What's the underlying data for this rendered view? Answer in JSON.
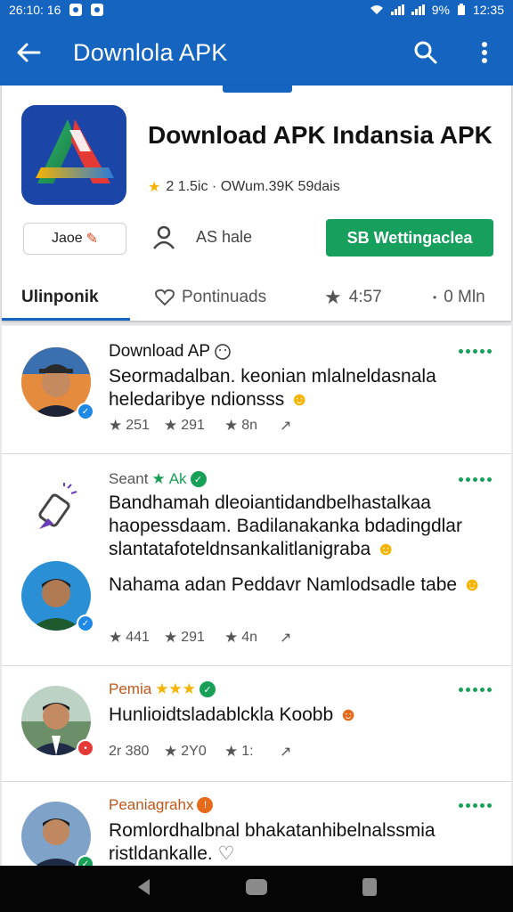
{
  "status_bar": {
    "time_left": "26:10: 16",
    "battery": "9%",
    "time_right": "12:35"
  },
  "app_bar": {
    "title": "Downlola APK"
  },
  "header": {
    "app_name": "Download APK Indansia APK",
    "rating_line": "2 1.5ic · OWum.39K 59dais",
    "chip_label": "Jaoe",
    "person_label": "AS hale",
    "install_label": "SB Wettingaclea",
    "tabs": [
      {
        "label": "Ulinponik"
      },
      {
        "label": "Pontinuads"
      },
      {
        "label": "4:57"
      },
      {
        "label": "0 Mln"
      }
    ]
  },
  "posts": [
    {
      "name": "Download AP",
      "text": "Seormadalban. keonian mlalneldasnala heledaribye ndionsss",
      "stats": [
        "251",
        "291",
        "8n"
      ]
    },
    {
      "name": "Seant",
      "name_tag": "Ak",
      "text": "Bandhamah dleoiantidandbelhastalkaa haopessdaam. Badilanakanka bdadingdlar slantatafoteldnsankalitlanigraba",
      "stats": []
    },
    {
      "name": "",
      "text": "Nahama adan Peddavr Namlodsadle tabe",
      "stats": [
        "441",
        "291",
        "4n"
      ]
    },
    {
      "name": "Pemia",
      "text": "Hunlioidtsladablckla Koobb",
      "stats": [
        "2r 380",
        "2Y0",
        "1:"
      ]
    },
    {
      "name": "Peaniagrahx",
      "text": "Romlordhalbnal bhakatanhibelnalssmia ristldankalle.",
      "stats": []
    }
  ],
  "colors": {
    "primary": "#1565c0",
    "accent_green": "#17a05d",
    "star": "#f5b400"
  }
}
